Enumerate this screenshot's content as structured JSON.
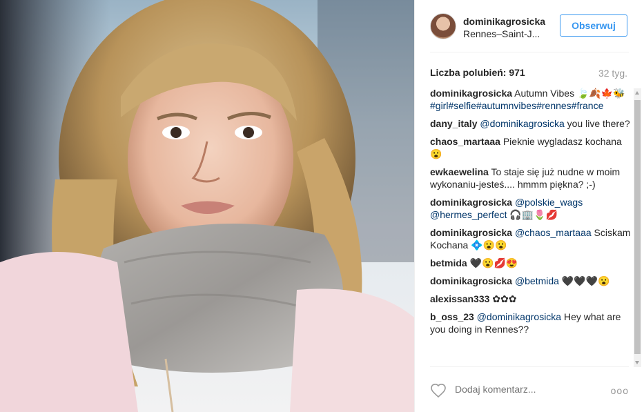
{
  "post": {
    "image_alt": "Selfie of a blonde woman wearing a grey scarf"
  },
  "header": {
    "username": "dominikagrosicka",
    "location": "Rennes–Saint-J...",
    "follow_label": "Obserwuj"
  },
  "stats": {
    "likes_label": "Liczba polubień: 971",
    "time_ago": "32 tyg."
  },
  "comments": [
    {
      "user": "dominikagrosicka",
      "text": " Autumn Vibes 🍃🍂🍁🐝",
      "tags": "#girl#selfie#autumnvibes#rennes#france"
    },
    {
      "user": "dany_italy",
      "mention": "@dominikagrosicka",
      "text": " you live there?"
    },
    {
      "user": "chaos_martaaa",
      "text": " Pieknie wygladasz kochana 😮"
    },
    {
      "user": "ewkaewelina",
      "text": " To staje się już nudne w moim wykonaniu-jesteś.... hmmm piękna? ;-)"
    },
    {
      "user": "dominikagrosicka",
      "mention": "@polskie_wags @hermes_perfect",
      "text": " 🎧🏢🌷💋"
    },
    {
      "user": "dominikagrosicka",
      "mention": "@chaos_martaaa",
      "text": " Sciskam Kochana 💠😮😮"
    },
    {
      "user": "betmida",
      "text": " 🖤😮💋😍"
    },
    {
      "user": "dominikagrosicka",
      "mention": "@betmida",
      "text": " 🖤🖤🖤😮"
    },
    {
      "user": "alexissan333",
      "text": " ✿✿✿"
    },
    {
      "user": "b_oss_23",
      "mention": "@dominikagrosicka",
      "text": " Hey what are you doing in Rennes??"
    }
  ],
  "footer": {
    "comment_placeholder": "Dodaj komentarz...",
    "more_label": "ooo"
  },
  "colors": {
    "follow_blue": "#3897f0",
    "mention_blue": "#003569",
    "muted_grey": "#999999"
  },
  "icons": {
    "like": "heart-outline-icon",
    "more": "more-options-icon"
  }
}
